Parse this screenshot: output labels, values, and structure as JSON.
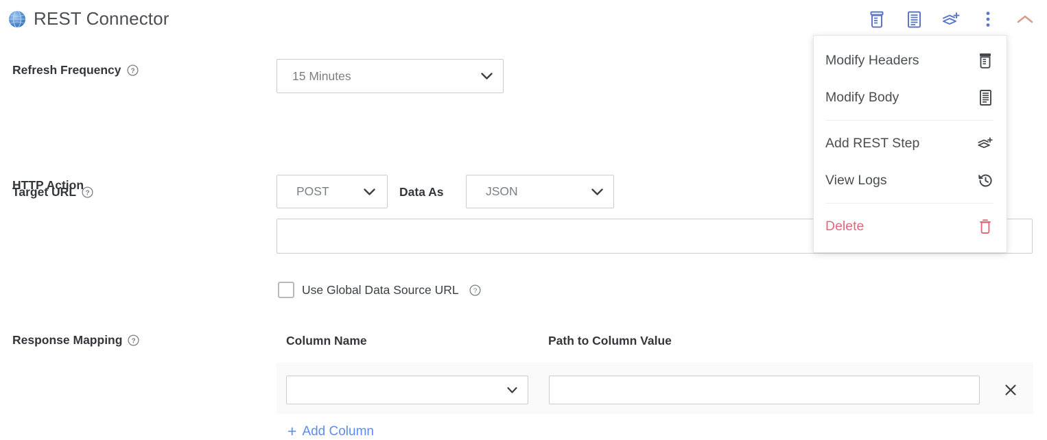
{
  "header": {
    "title": "REST Connector",
    "icon": "globe-icon",
    "toolbar": [
      {
        "name": "modify-headers-icon",
        "label": "Modify Headers"
      },
      {
        "name": "modify-body-icon",
        "label": "Modify Body"
      },
      {
        "name": "add-rest-step-icon",
        "label": "Add REST Step"
      },
      {
        "name": "more-options-icon",
        "label": "More options"
      },
      {
        "name": "collapse-chevron-up-icon",
        "label": "Collapse"
      }
    ]
  },
  "menu": {
    "items": [
      {
        "label": "Modify Headers",
        "icon": "modify-headers-icon",
        "danger": false
      },
      {
        "label": "Modify Body",
        "icon": "modify-body-icon",
        "danger": false
      },
      {
        "label": "Add REST Step",
        "icon": "add-rest-step-icon",
        "danger": false
      },
      {
        "label": "View Logs",
        "icon": "history-clock-icon",
        "danger": false
      },
      {
        "label": "Delete",
        "icon": "trash-icon",
        "danger": true
      }
    ]
  },
  "form": {
    "refresh_frequency": {
      "label": "Refresh Frequency",
      "value": "15 Minutes"
    },
    "http_action": {
      "label": "HTTP Action",
      "method_value": "POST",
      "data_as_label": "Data As",
      "data_as_value": "JSON"
    },
    "target_url": {
      "label": "Target URL",
      "value": "",
      "placeholder": ""
    },
    "use_global_url": {
      "label": "Use Global Data Source URL",
      "checked": false
    },
    "response_mapping": {
      "label": "Response Mapping",
      "columns": [
        "Column Name",
        "Path to Column Value"
      ],
      "rows": [
        {
          "column_name": "",
          "path_to_value": ""
        }
      ],
      "add_column_label": "Add Column",
      "add_column_plus": "+",
      "remove_glyph": "✕"
    }
  },
  "colors": {
    "accent_blue": "#5b8def",
    "icon_blue": "#5a76c4",
    "danger_red": "#e2687c",
    "collapse_chevron": "#d89c8e",
    "text_dark": "#33373b",
    "text_muted": "#7b7f85",
    "border": "#c9cdd1",
    "band": "#fafafa"
  }
}
